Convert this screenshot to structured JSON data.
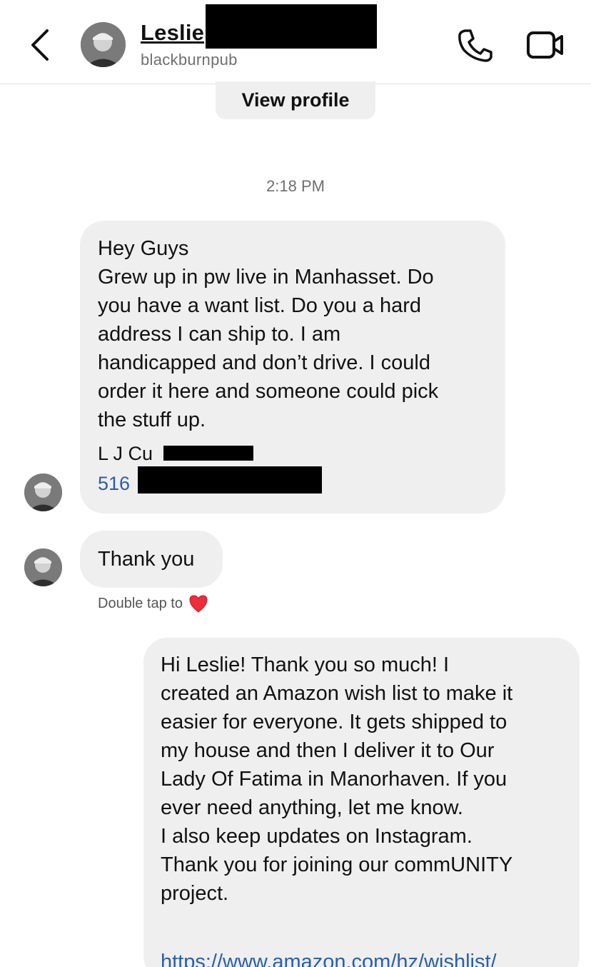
{
  "header": {
    "contact_name": "Leslie",
    "handle": "blackburnpub"
  },
  "view_profile_label": "View profile",
  "timestamp": "2:18 PM",
  "messages": {
    "incoming_1": {
      "lines": [
        "Hey Guys",
        "Grew up in pw live in Manhasset. Do",
        "you have a want list. Do you a hard",
        "address I can ship to. I am",
        "handicapped and don’t drive. I could",
        "order it here and someone could pick",
        "the stuff up."
      ],
      "signature": "L J Cu",
      "phone_prefix": "516"
    },
    "incoming_2": {
      "text": "Thank you"
    },
    "double_tap_hint": "Double tap to",
    "outgoing_1": {
      "lines": [
        "Hi Leslie! Thank you so much! I",
        "created an Amazon wish list to make it",
        "easier for everyone. It gets shipped to",
        "my house and then I deliver it to Our",
        "Lady Of Fatima in Manorhaven. If you",
        "ever need anything, let me know.",
        "I also keep updates on Instagram.",
        "Thank you for joining our commUNITY",
        "project."
      ],
      "link": "https://www.amazon.com/hz/wishlist/"
    }
  },
  "colors": {
    "bubble": "#efefef",
    "link": "#2b5fa6",
    "heart": "#ed2d3c"
  },
  "icons": {
    "back": "chevron-left-icon",
    "call": "phone-icon",
    "video": "video-camera-icon",
    "like": "heart-icon"
  }
}
